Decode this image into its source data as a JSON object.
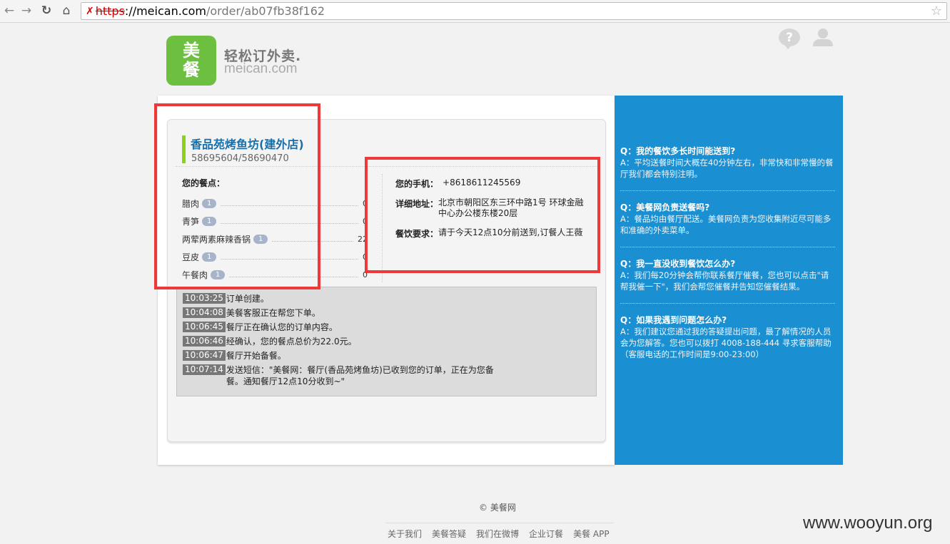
{
  "browser": {
    "url_scheme": "https",
    "url_domain": "://meican.com",
    "url_path": "/order/ab07fb38f162"
  },
  "header": {
    "logo_char1": "美",
    "logo_char2": "餐",
    "slogan": "轻松订外卖.",
    "domain": "meican.com",
    "help_label": "?"
  },
  "order": {
    "restaurant_name": "香品苑烤鱼坊(建外店)",
    "restaurant_phone": "58695604/58690470",
    "dishes_title": "您的餐点：",
    "dishes": [
      {
        "name": "腊肉",
        "qty": "1",
        "price": "0"
      },
      {
        "name": "青笋",
        "qty": "1",
        "price": "0"
      },
      {
        "name": "两荤两素麻辣香锅",
        "qty": "1",
        "price": "22"
      },
      {
        "name": "豆皮",
        "qty": "1",
        "price": "0"
      },
      {
        "name": "午餐肉",
        "qty": "1",
        "price": "0"
      }
    ],
    "phone_label": "您的手机：",
    "phone_value": "+8618611245569",
    "address_label": "详细地址：",
    "address_value": "北京市朝阳区东三环中路1号 环球金融中心办公楼东楼20层",
    "request_label": "餐饮要求：",
    "request_value": "请于今天12点10分前送到,订餐人王薇"
  },
  "log": [
    {
      "time": "10:03:25",
      "text": "订单创建。"
    },
    {
      "time": "10:04:08",
      "text": "美餐客服正在帮您下单。"
    },
    {
      "time": "10:06:45",
      "text": "餐厅正在确认您的订单内容。"
    },
    {
      "time": "10:06:46",
      "text": "经确认，您的餐点总价为22.0元。"
    },
    {
      "time": "10:06:47",
      "text": "餐厅开始备餐。"
    },
    {
      "time": "10:07:14",
      "text": "发送短信：\"美餐网：餐厅(香品苑烤鱼坊)已收到您的订单，正在为您备餐。通知餐厅12点10分收到~\""
    }
  ],
  "faq": [
    {
      "q": "Q：我的餐饮多长时间能送到?",
      "a": "A：平均送餐时间大概在40分钟左右，非常快和非常慢的餐厅我们都会特别注明。"
    },
    {
      "q": "Q：美餐网负责送餐吗?",
      "a": "A：餐品均由餐厅配送。美餐网负责为您收集附近尽可能多和准确的外卖菜单。"
    },
    {
      "q": "Q：我一直没收到餐饮怎么办?",
      "a": "A：我们每20分钟会帮你联系餐厅催餐，您也可以点击\"请帮我催一下\"，我们会帮您催餐并告知您催餐结果。"
    },
    {
      "q": "Q：如果我遇到问题怎么办?",
      "a": "A：我们建议您通过我的答疑提出问题，最了解情况的人员会为您解答。您也可以拨打 4008-188-444 寻求客服帮助（客服电话的工作时间是9:00-23:00）"
    }
  ],
  "footer": {
    "copyright": "© 美餐网",
    "links": [
      "关于我们",
      "美餐答疑",
      "我们在微博",
      "企业订餐",
      "美餐 APP"
    ]
  },
  "watermark": "www.wooyun.org",
  "colors": {
    "brand_green": "#6cbf3f",
    "faq_blue": "#1a8fd1",
    "highlight_red": "#ef3838",
    "link_blue": "#1a6fa8"
  }
}
